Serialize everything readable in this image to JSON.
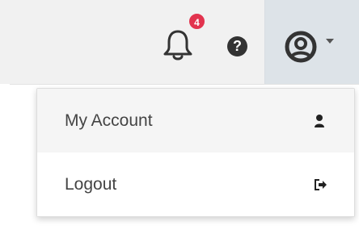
{
  "topbar": {
    "notifications": {
      "count": "4",
      "icon": "bell-icon",
      "badge_color": "#e2334e"
    },
    "help": {
      "glyph": "?",
      "icon": "question-circle-icon"
    },
    "user_menu": {
      "icon": "user-circle-icon",
      "caret_icon": "caret-down-icon",
      "active_background": "#dde3e8"
    }
  },
  "dropdown": {
    "items": [
      {
        "label": "My Account",
        "icon": "user-icon"
      },
      {
        "label": "Logout",
        "icon": "sign-out-icon"
      }
    ]
  }
}
